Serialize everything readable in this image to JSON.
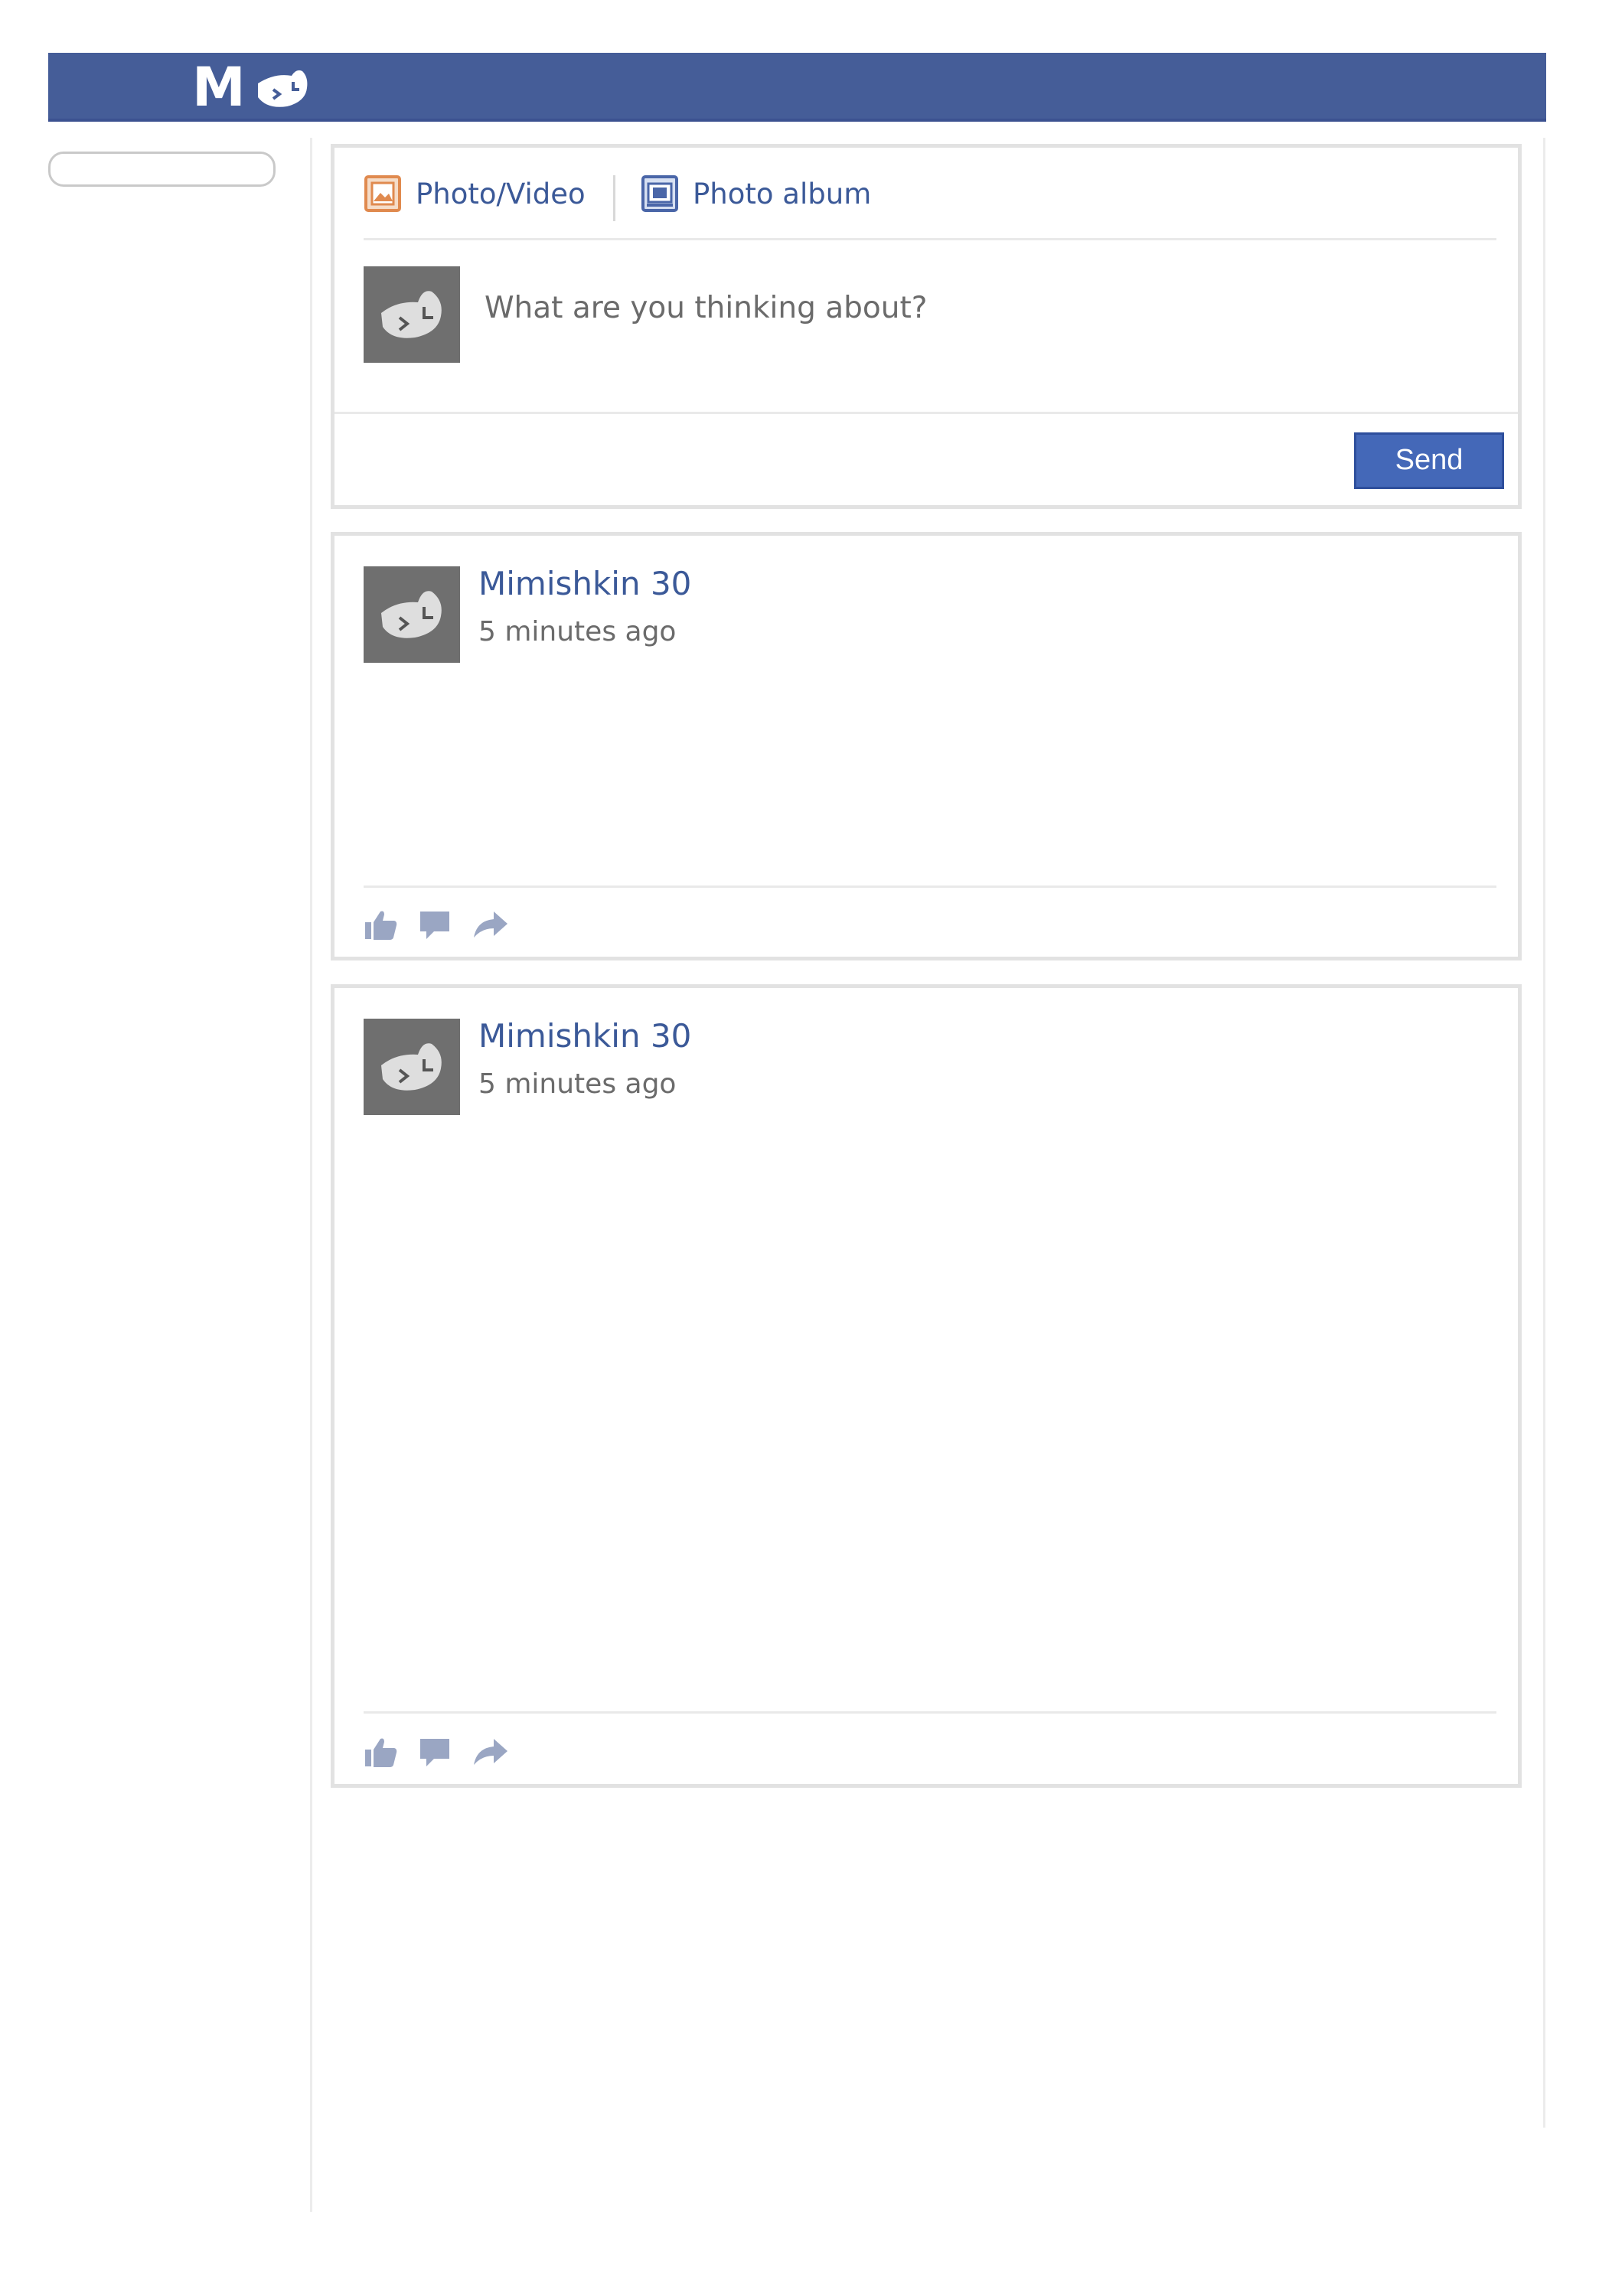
{
  "app": {
    "logo_text": "M",
    "colors": {
      "topbar": "#455d98",
      "link": "#3b5998",
      "send_button": "#4468b8"
    }
  },
  "composer": {
    "tabs": [
      {
        "label": "Photo/Video",
        "icon": "photo-video-icon"
      },
      {
        "label": "Photo album",
        "icon": "photo-album-icon"
      }
    ],
    "placeholder": "What are you thinking about?",
    "send_label": "Send",
    "avatar_icon": "cat-mask-avatar-icon"
  },
  "posts": [
    {
      "author": "Mimishkin 30",
      "time": "5 minutes ago",
      "actions": [
        "like-icon",
        "comment-icon",
        "share-icon"
      ]
    },
    {
      "author": "Mimishkin 30",
      "time": "5 minutes ago",
      "actions": [
        "like-icon",
        "comment-icon",
        "share-icon"
      ]
    }
  ]
}
